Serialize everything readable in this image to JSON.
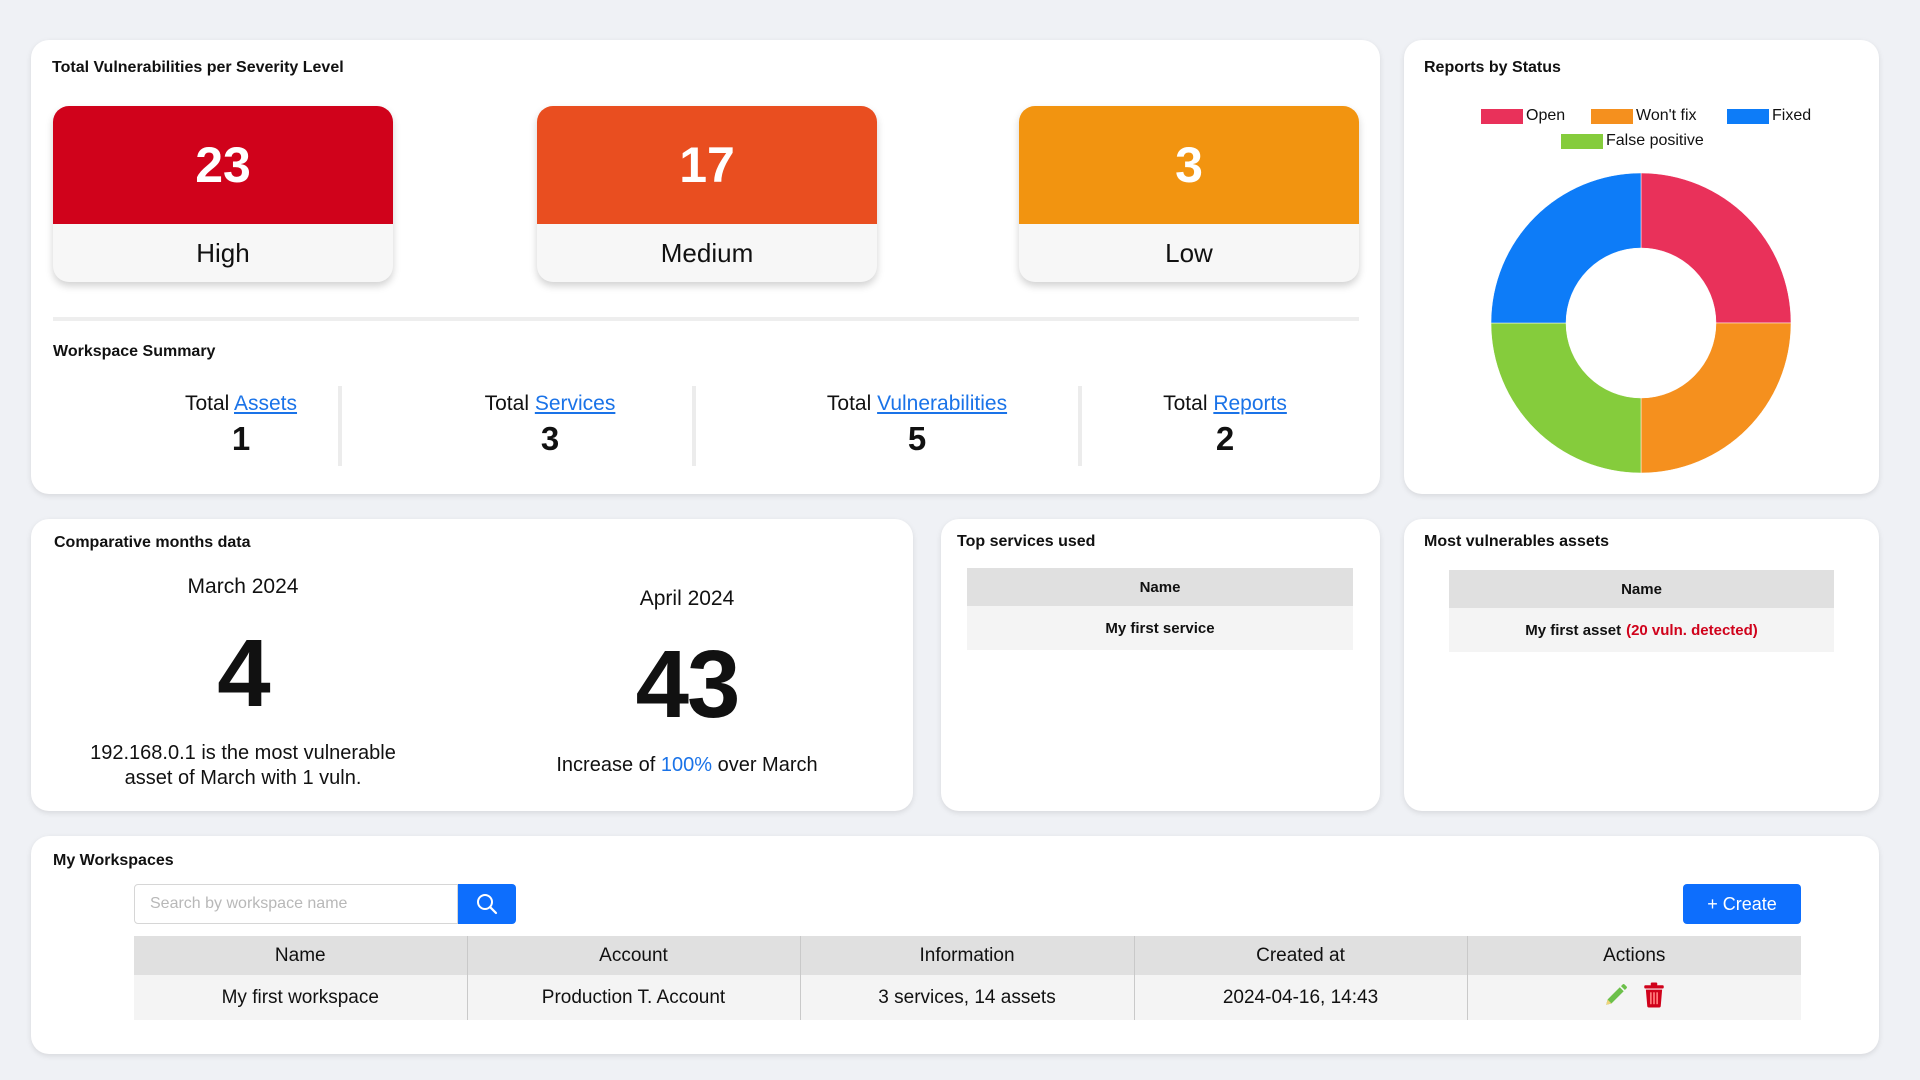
{
  "severity": {
    "title": "Total Vulnerabilities per Severity Level",
    "items": [
      {
        "count": "23",
        "label": "High",
        "color": "#d0021b"
      },
      {
        "count": "17",
        "label": "Medium",
        "color": "#e94e20"
      },
      {
        "count": "3",
        "label": "Low",
        "color": "#f29410"
      }
    ]
  },
  "summary": {
    "title": "Workspace Summary",
    "prefix": "Total",
    "items": [
      {
        "link": "Assets",
        "value": "1"
      },
      {
        "link": "Services",
        "value": "3"
      },
      {
        "link": "Vulnerabilities",
        "value": "5"
      },
      {
        "link": "Reports",
        "value": "2"
      }
    ]
  },
  "reports": {
    "title": "Reports by Status",
    "legend": [
      {
        "label": "Open",
        "color": "#e9315a"
      },
      {
        "label": "Won't fix",
        "color": "#f5901e"
      },
      {
        "label": "Fixed",
        "color": "#0d7cf8"
      },
      {
        "label": "False positive",
        "color": "#85cc3c"
      }
    ]
  },
  "chart_data": {
    "type": "pie",
    "variant": "doughnut",
    "categories": [
      "Open",
      "Won't fix",
      "False positive",
      "Fixed"
    ],
    "values": [
      1,
      1,
      1,
      1
    ],
    "colors": [
      "#e9315a",
      "#f5901e",
      "#85cc3c",
      "#0d7cf8"
    ],
    "legend_position": "top"
  },
  "comparative": {
    "title": "Comparative months data",
    "left": {
      "month": "March 2024",
      "value": "4",
      "line1": "192.168.0.1 is the most vulnerable",
      "line2": "asset of March with 1 vuln."
    },
    "right": {
      "month": "April 2024",
      "value": "43",
      "text_before": "Increase of ",
      "highlight": "100%",
      "text_after": " over March"
    }
  },
  "top_services": {
    "title": "Top services used",
    "header": "Name",
    "rows": [
      "My first service"
    ]
  },
  "vuln_assets": {
    "title": "Most vulnerables assets",
    "header": "Name",
    "rows": [
      {
        "name": "My first asset",
        "note": "(20 vuln. detected)"
      }
    ]
  },
  "workspaces": {
    "title": "My Workspaces",
    "search_placeholder": "Search by workspace name",
    "create_label": "+ Create",
    "columns": [
      "Name",
      "Account",
      "Information",
      "Created at",
      "Actions"
    ],
    "rows": [
      {
        "name": "My first workspace",
        "account": "Production T. Account",
        "info": "3 services, 14 assets",
        "created": "2024-04-16, 14:43"
      }
    ],
    "icons": {
      "edit": "pencil-icon",
      "delete": "trash-icon",
      "search": "search-icon"
    }
  }
}
